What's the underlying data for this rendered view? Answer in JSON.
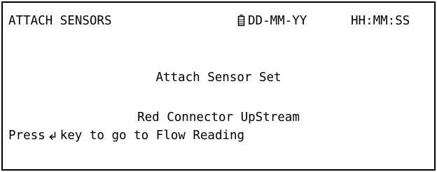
{
  "header": {
    "title": "ATTACH SENSORS",
    "battery_icon": "battery-icon",
    "date": "DD-MM-YY",
    "time": "HH:MM:SS"
  },
  "main": {
    "heading": "Attach Sensor Set",
    "connector_instruction": "Red Connector UpStream",
    "press_text": "Press",
    "enter_key_icon": "enter-key-icon",
    "action_text": "key to go to Flow Reading"
  },
  "colors": {
    "text": "#000000",
    "background": "#ffffff",
    "border": "#000000"
  }
}
